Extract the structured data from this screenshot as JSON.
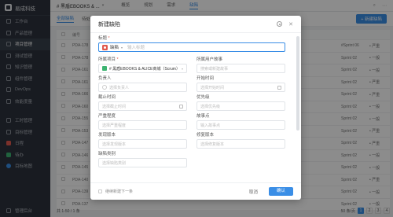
{
  "app": {
    "name": "易成科技"
  },
  "sidebar": {
    "items": [
      {
        "label": "工作台"
      },
      {
        "label": "产品管理"
      },
      {
        "label": "项目管理"
      },
      {
        "label": "测试管理"
      },
      {
        "label": "知识管理"
      },
      {
        "label": "组件管理"
      },
      {
        "label": "DevOps"
      },
      {
        "label": "效能度量"
      }
    ],
    "items2": [
      {
        "label": "工时管理"
      },
      {
        "label": "目标管理"
      },
      {
        "label": "日程"
      },
      {
        "label": "待办"
      },
      {
        "label": "目标地图"
      }
    ],
    "bottom": "管理后台"
  },
  "topbar": {
    "project": "# 黑盾EBOOKS & ...",
    "nav": [
      "概览",
      "规划",
      "需求",
      "缺陷"
    ],
    "active_nav": "缺陷"
  },
  "subbar": {
    "tab_all": "全部缺陷",
    "tab_mine": "待处理",
    "new_button": "+ 新建缺陷"
  },
  "table": {
    "headers": [
      "编号",
      "",
      "",
      "",
      ""
    ],
    "rows": [
      {
        "id": "PDA-178",
        "sprint": "#Sprint 06",
        "status": "• 严重"
      },
      {
        "id": "PDA-178",
        "sprint": "Sprint 02",
        "status": "• 一般"
      },
      {
        "id": "PDA-161",
        "sprint": "Sprint 02",
        "status": "• 一般"
      },
      {
        "id": "PDA-161",
        "sprint": "Sprint 02",
        "status": "• 严重"
      },
      {
        "id": "PDA-166",
        "sprint": "Sprint 02",
        "status": "• 严重"
      },
      {
        "id": "PDA-160",
        "sprint": "Sprint 02",
        "status": "• 一般"
      },
      {
        "id": "PDA-155",
        "sprint": "Sprint 02",
        "status": "• 一般"
      },
      {
        "id": "PDA-153",
        "sprint": "Sprint 02",
        "status": "• 严重"
      },
      {
        "id": "PDA-147",
        "sprint": "Sprint 02",
        "status": "• 严重"
      },
      {
        "id": "PDA-146",
        "sprint": "Sprint 02",
        "status": "• 一般"
      },
      {
        "id": "PDA-145",
        "sprint": "Sprint 02",
        "status": "• 一般"
      },
      {
        "id": "PDA-140",
        "sprint": "Sprint 02",
        "status": "• 严重"
      },
      {
        "id": "PDA-139",
        "sprint": "Sprint 02",
        "status": "• 一般"
      },
      {
        "id": "PDA-137",
        "sprint": "Sprint 02",
        "status": "• 一般"
      }
    ]
  },
  "pager": {
    "summary": "共 1-50 / 1 条",
    "per_page": "50 条/页",
    "pages": [
      "1",
      "2",
      "3",
      "4"
    ]
  },
  "modal": {
    "title": "新建缺陷",
    "fields": {
      "title_label": "标题",
      "type_value": "缺陷",
      "title_placeholder": "输入标题",
      "project_label": "所属项目",
      "project_value": "# 黑盾EBOOKS & ALICE商城（Scrum）",
      "user_story_label": "所属用户故事",
      "user_story_placeholder": "搜索或新建故事",
      "assignee_label": "负责人",
      "assignee_placeholder": "选择负责人",
      "start_label": "开始时间",
      "start_placeholder": "选择开始时间",
      "due_label": "截止时间",
      "due_placeholder": "选择截止时间",
      "priority_label": "优先级",
      "priority_placeholder": "选择优先级",
      "severity_label": "严重程度",
      "severity_placeholder": "选择严重程度",
      "points_label": "故事点",
      "points_placeholder": "输入故事点",
      "found_version_label": "发现版本",
      "found_version_placeholder": "选择发现版本",
      "fix_version_label": "修复版本",
      "fix_version_placeholder": "选择修复版本",
      "defect_type_label": "缺陷类别",
      "defect_type_placeholder": "选择缺陷类别"
    },
    "footer": {
      "continue_label": "继续新建下一条",
      "cancel": "取消",
      "ok": "确认"
    }
  }
}
